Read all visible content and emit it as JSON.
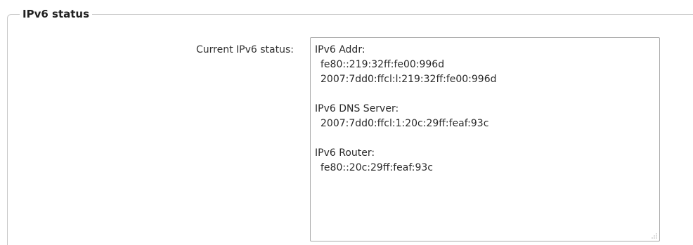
{
  "section": {
    "legend": "IPv6 status"
  },
  "status_field": {
    "label": "Current IPv6 status:",
    "lines": [
      "IPv6 Addr:",
      "fe80::219:32ff:fe00:996d",
      "2007:7dd0:ffcl:l:219:32ff:fe00:996d",
      "IPv6 DNS Server:",
      "2007:7dd0:ffcl:1:20c:29ff:feaf:93c",
      "IPv6 Router:",
      "fe80::20c:29ff:feaf:93c"
    ]
  },
  "icons": {
    "resize_grip": "resize-grip-icon"
  },
  "colors": {
    "border": "#c8c8c8",
    "text": "#333333",
    "box_border": "#aaaaaa"
  }
}
